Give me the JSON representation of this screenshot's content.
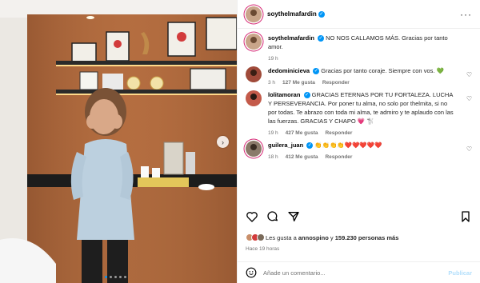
{
  "post": {
    "author": "soythelmafardin",
    "dots_count": 5,
    "active_dot": 0
  },
  "caption": {
    "author": "soythelmafardin",
    "text": "NO NOS CALLAMOS MÁS. Gracias por tanto amor.",
    "time": "19 h"
  },
  "comments": [
    {
      "author": "dedominicieva",
      "verified": true,
      "text": "Gracias por tanto coraje. Siempre con vos. 💚",
      "time": "3 h",
      "likes": "127 Me gusta",
      "reply": "Responder"
    },
    {
      "author": "lolitamoran",
      "verified": true,
      "text": "GRACIAS ETERNAS POR TU FORTALEZA. LUCHA Y PERSEVERANCIA. Por poner tu alma, no solo por thelmita, si no por todas. Te abrazo con toda mi alma, te admiro y te aplaudo con las las fuerzas. GRACIAS Y CHAPO 💗 🐩",
      "time": "19 h",
      "likes": "427 Me gusta",
      "reply": "Responder"
    },
    {
      "author": "guilera_juan",
      "verified": true,
      "text": "👏👏👏👏❤️❤️❤️❤️❤️",
      "time": "18 h",
      "likes": "412 Me gusta",
      "reply": "Responder"
    }
  ],
  "likes_summary": {
    "prefix": "Les gusta a",
    "user": "annospino",
    "middle": "y",
    "count": "159.230 personas más"
  },
  "posted_ago": "Hace 19 horas",
  "add_comment": {
    "placeholder": "Añade un comentario...",
    "publish": "Publicar"
  },
  "colors": {
    "accent": "#0095f6",
    "publish_disabled": "#b2dffc",
    "muted": "#737373"
  },
  "icons": [
    "more-icon",
    "heart-icon",
    "comment-icon",
    "share-icon",
    "save-icon",
    "emoji-icon",
    "next-icon",
    "verified-icon"
  ]
}
